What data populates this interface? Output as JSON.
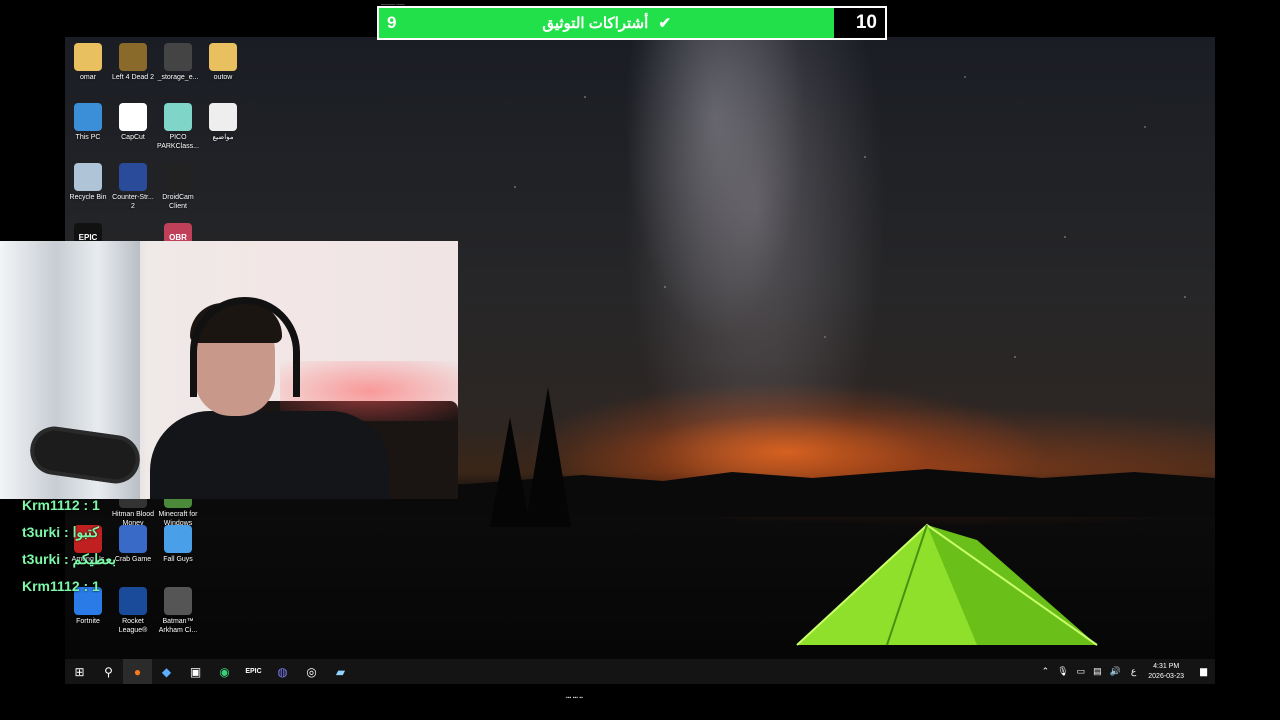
{
  "top_bar": {
    "tiny_caption": "_____ ___",
    "current": "9",
    "goal_label": "أشتراكات التوثيق",
    "target": "10",
    "progress_fraction": 0.9,
    "colors": {
      "bar": "#22e04a",
      "frame": "#ffffff"
    }
  },
  "desktop_icons": [
    {
      "label": "omar",
      "icon": "user-folder-icon",
      "color": "#e8c060"
    },
    {
      "label": "Left 4 Dead 2",
      "icon": "game-icon",
      "color": "#8a6a2a"
    },
    {
      "label": "_storage_e...",
      "icon": "file-icon",
      "color": "#444444"
    },
    {
      "label": "outow",
      "icon": "folder-icon",
      "color": "#e8c060"
    },
    {
      "label": "This PC",
      "icon": "computer-icon",
      "color": "#3a8fd8"
    },
    {
      "label": "CapCut",
      "icon": "capcut-icon",
      "color": "#ffffff"
    },
    {
      "label": "PICO PARKClass...",
      "icon": "game-icon",
      "color": "#7fd6c8"
    },
    {
      "label": "مواضيع",
      "icon": "document-icon",
      "color": "#eeeeee"
    },
    {
      "label": "Recycle Bin",
      "icon": "recycle-bin-icon",
      "color": "#b0c4d8"
    },
    {
      "label": "Counter-Str... 2",
      "icon": "game-icon",
      "color": "#2a4a9a"
    },
    {
      "label": "DroidCam Client",
      "icon": "camera-icon",
      "color": "#222222"
    },
    {
      "label": "Hitman Blood Money",
      "icon": "game-icon",
      "color": "#333333"
    },
    {
      "label": "Minecraft for Windows",
      "icon": "game-icon",
      "color": "#4a8a3a"
    },
    {
      "label": "Among Us",
      "icon": "game-icon",
      "color": "#c02020"
    },
    {
      "label": "Crab Game",
      "icon": "game-icon",
      "color": "#3a6ac8"
    },
    {
      "label": "Fall Guys",
      "icon": "game-icon",
      "color": "#4aa0e8"
    },
    {
      "label": "Fortnite",
      "icon": "game-icon",
      "color": "#2a7ae8"
    },
    {
      "label": "Rocket League®",
      "icon": "game-icon",
      "color": "#1a4a9a"
    },
    {
      "label": "Batman™ Arkham Ci...",
      "icon": "game-icon",
      "color": "#555555"
    }
  ],
  "partial_icons": {
    "epic": "EPIC",
    "obr": "OBR"
  },
  "chat": [
    {
      "text": "Krm1112 : 1"
    },
    {
      "text": "t3urki : كتبوا"
    },
    {
      "text": "t3urki : بعطيكم"
    },
    {
      "text": "Krm1112 : 1"
    }
  ],
  "taskbar": {
    "apps": [
      "start-icon",
      "search-icon",
      "firefox-icon",
      "copilot-icon",
      "store-icon",
      "ubisoft-icon",
      "epic-icon",
      "discord-icon",
      "obs-icon",
      "app-icon"
    ],
    "tray_lang": "ع",
    "time": "4:31 PM",
    "date": "2026-03-23"
  },
  "bottom_caption": "▪▪▪ ▪▪▪ ▪▪"
}
